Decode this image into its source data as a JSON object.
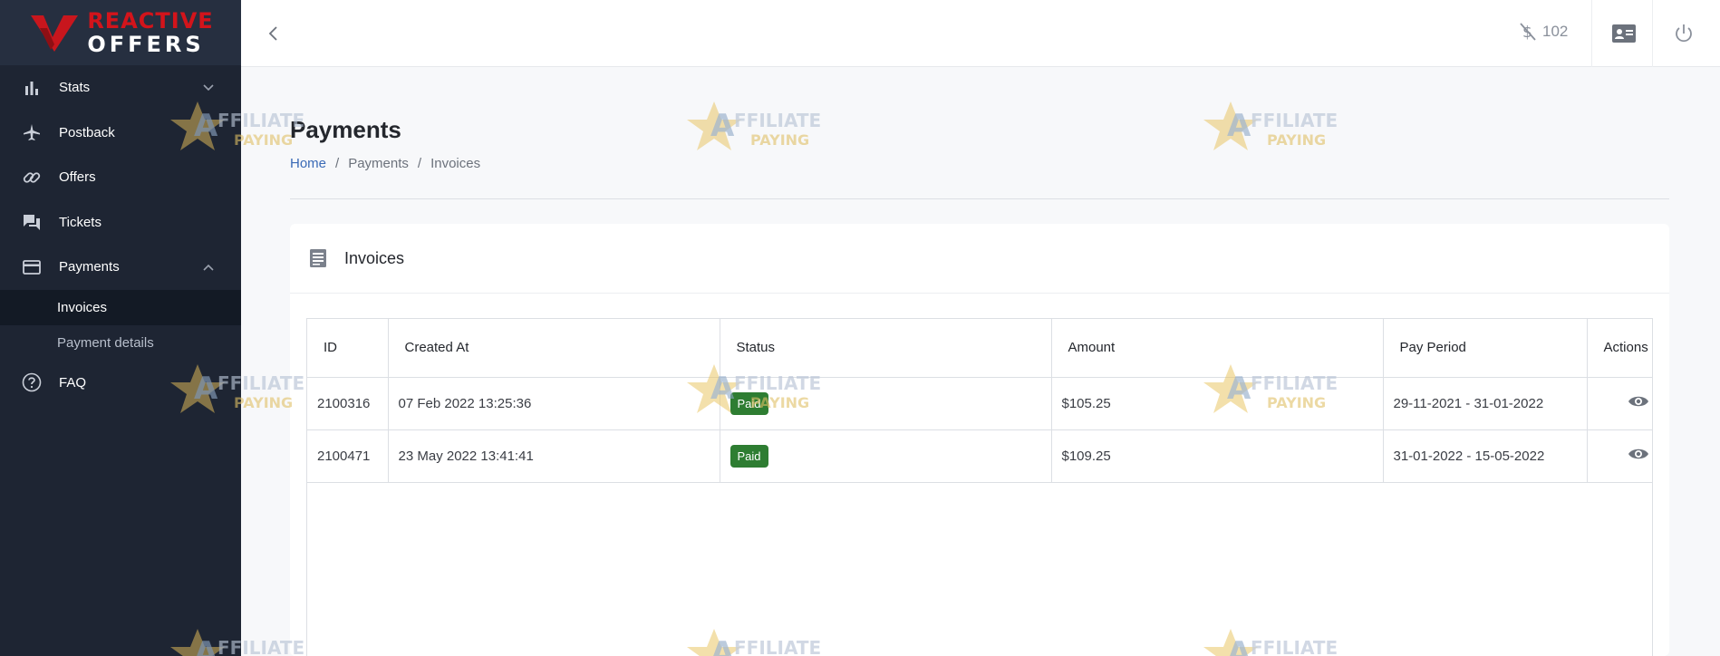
{
  "brand": {
    "line1": "REACTIVE",
    "line2": "OFFERS"
  },
  "sidebar": {
    "items": [
      {
        "label": "Stats",
        "icon": "bar-chart-icon",
        "chevron": "down"
      },
      {
        "label": "Postback",
        "icon": "airplane-icon"
      },
      {
        "label": "Offers",
        "icon": "link-icon"
      },
      {
        "label": "Tickets",
        "icon": "chat-icon"
      },
      {
        "label": "Payments",
        "icon": "credit-card-icon",
        "chevron": "up"
      },
      {
        "label": "FAQ",
        "icon": "help-circle-icon"
      }
    ],
    "sub_items": [
      {
        "label": "Invoices",
        "active": true
      },
      {
        "label": "Payment details",
        "active": false
      }
    ]
  },
  "topbar": {
    "balance": "102",
    "icons": [
      "dollar-off-icon",
      "profile-card-icon",
      "power-icon"
    ]
  },
  "page": {
    "title": "Payments",
    "breadcrumb": [
      "Home",
      "Payments",
      "Invoices"
    ],
    "breadcrumb_separator": "/"
  },
  "card": {
    "title": "Invoices",
    "table": {
      "columns": [
        "ID",
        "Created At",
        "Status",
        "Amount",
        "Pay Period",
        "Actions"
      ],
      "rows": [
        {
          "id": "2100316",
          "created_at": "07 Feb 2022 13:25:36",
          "status": "Paid",
          "amount": "$105.25",
          "pay_period": "29-11-2021 - 31-01-2022"
        },
        {
          "id": "2100471",
          "created_at": "23 May 2022 13:41:41",
          "status": "Paid",
          "amount": "$109.25",
          "pay_period": "31-01-2022 - 15-05-2022"
        }
      ]
    }
  },
  "watermark": {
    "line1": "AFFILIATE",
    "line2": "PAYING"
  },
  "colors": {
    "sidebar": "#1e2533",
    "accent_link": "#3a6ab6",
    "paid_badge": "#2e7d32",
    "brand_red": "#d3141b"
  }
}
